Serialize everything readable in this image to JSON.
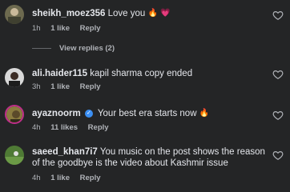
{
  "comments": [
    {
      "username": "sheikh_moez356",
      "text": "Love you",
      "emojis": [
        "🔥",
        "💗"
      ],
      "time": "1h",
      "likes": "1 like",
      "reply_label": "Reply"
    },
    {
      "username": "ali.haider115",
      "text": "kapil sharma copy ended",
      "time": "3h",
      "likes": "1 like",
      "reply_label": "Reply"
    },
    {
      "username": "ayaznoorm",
      "text": "Your best era starts now",
      "emojis": [
        "🔥"
      ],
      "time": "4h",
      "likes": "11 likes",
      "reply_label": "Reply"
    },
    {
      "username": "saeed_khan7i7",
      "text": "You music on the post shows the reason of the goodbye is the video about Kashmir issue",
      "time": "4h",
      "likes": "1 like",
      "reply_label": "Reply"
    }
  ],
  "view_replies_label": "View replies (2)",
  "icons": {
    "like": "heart-icon",
    "verified": "verified-badge-icon"
  }
}
